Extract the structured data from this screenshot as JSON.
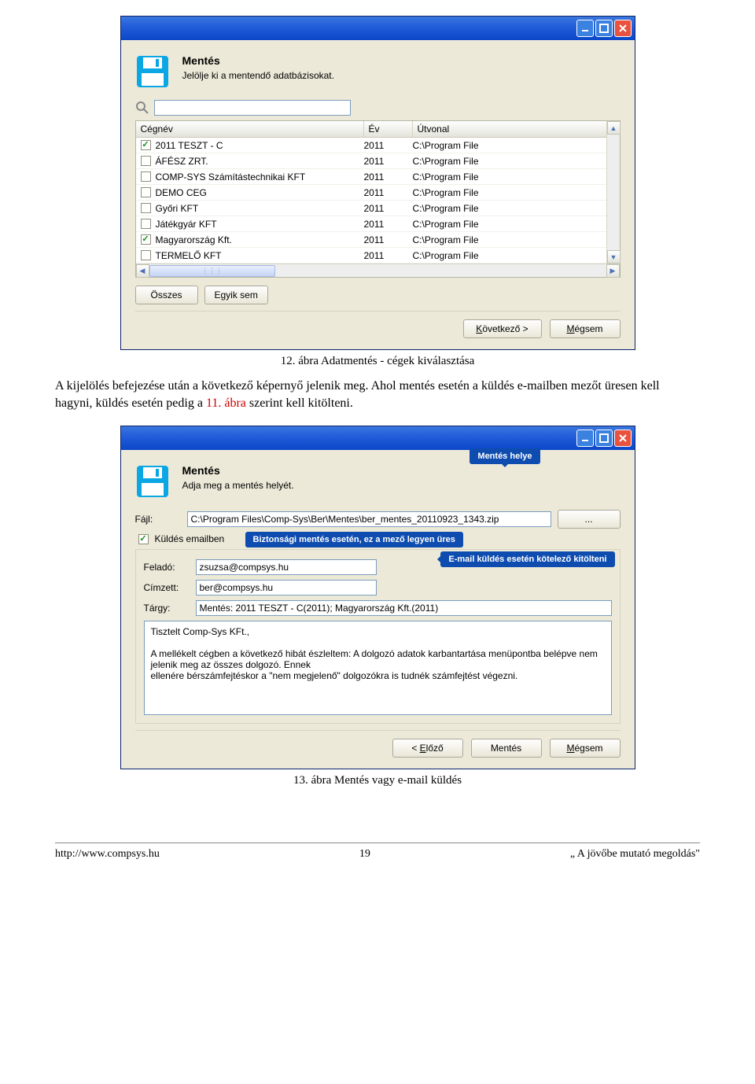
{
  "dialog1": {
    "title": "Mentés",
    "subtitle": "Jelölje ki a mentendő adatbázisokat.",
    "columns": {
      "c1": "Cégnév",
      "c2": "Év",
      "c3": "Útvonal"
    },
    "rows": [
      {
        "checked": true,
        "name": "2011 TESZT - C",
        "year": "2011",
        "path": "C:\\Program File"
      },
      {
        "checked": false,
        "name": "ÁFÉSZ ZRT.",
        "year": "2011",
        "path": "C:\\Program File"
      },
      {
        "checked": false,
        "name": "COMP-SYS Számítástechnikai KFT",
        "year": "2011",
        "path": "C:\\Program File"
      },
      {
        "checked": false,
        "name": "DEMO CEG",
        "year": "2011",
        "path": "C:\\Program File"
      },
      {
        "checked": false,
        "name": "Győri KFT",
        "year": "2011",
        "path": "C:\\Program File"
      },
      {
        "checked": false,
        "name": "Játékgyár KFT",
        "year": "2011",
        "path": "C:\\Program File"
      },
      {
        "checked": true,
        "name": "Magyarország Kft.",
        "year": "2011",
        "path": "C:\\Program File"
      },
      {
        "checked": false,
        "name": "TERMELŐ KFT",
        "year": "2011",
        "path": "C:\\Program File"
      }
    ],
    "select_all": "Összes",
    "select_none": "Egyik sem",
    "next": "Következő >",
    "cancel": "Mégsem"
  },
  "caption1": "12. ábra Adatmentés - cégek kiválasztása",
  "body": {
    "part1": "A kijelölés befejezése után a következő képernyő jelenik meg. Ahol mentés esetén a küldés e-mailben mezőt üresen kell hagyni, küldés esetén pedig a ",
    "red": "11. ábra",
    "part2": " szerint kell kitölteni."
  },
  "dialog2": {
    "title": "Mentés",
    "subtitle": "Adja meg a mentés helyét.",
    "file_label": "Fájl:",
    "file_value": "C:\\Program Files\\Comp-Sys\\Ber\\Mentes\\ber_mentes_20110923_1343.zip",
    "browse": "...",
    "send_email_label": "Küldés emailben",
    "from_label": "Feladó:",
    "from_value": "zsuzsa@compsys.hu",
    "to_label": "Címzett:",
    "to_value": "ber@compsys.hu",
    "subject_label": "Tárgy:",
    "subject_value": "Mentés: 2011 TESZT - C(2011); Magyarország Kft.(2011)",
    "message": "Tisztelt Comp-Sys KFt.,\n\nA mellékelt cégben a következő hibát észleltem: A dolgozó adatok karbantartása menüpontba belépve nem jelenik meg az összes dolgozó. Ennek\nellenére bérszámfejtéskor a \"nem megjelenő\" dolgozókra is tudnék számfejtést végezni.",
    "prev": "< Előző",
    "save": "Mentés",
    "cancel": "Mégsem",
    "callout_location": "Mentés helye",
    "callout_sec": "Biztonsági mentés esetén, ez a mező legyen üres",
    "callout_email": "E-mail küldés esetén kötelező kitölteni"
  },
  "caption2": "13. ábra Mentés vagy e-mail küldés",
  "footer": {
    "url": "http://www.compsys.hu",
    "page": "19",
    "slogan": "„ A jövőbe mutató megoldás\""
  }
}
